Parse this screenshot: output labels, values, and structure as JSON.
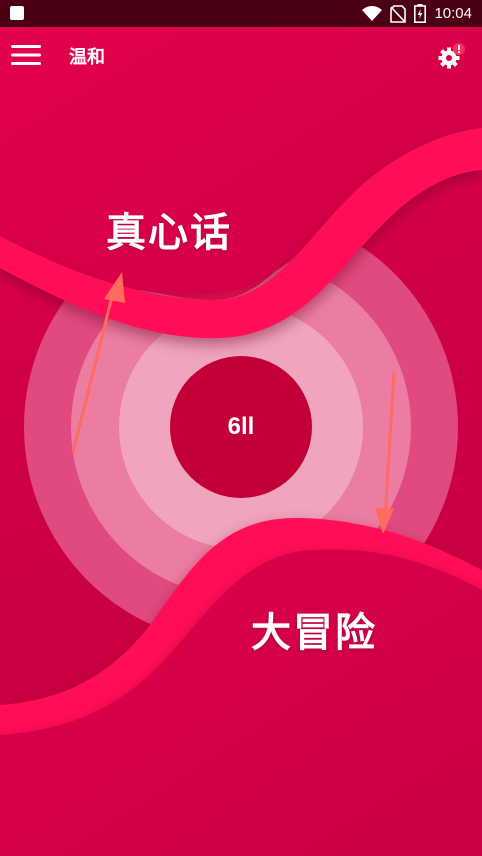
{
  "status_bar": {
    "time": "10:04",
    "icons": [
      "stop-square-icon",
      "wifi-icon",
      "no-sim-icon",
      "battery-charging-icon"
    ]
  },
  "app_bar": {
    "menu_icon": "hamburger-menu-icon",
    "mode_label": "温和",
    "settings_icon": "gear-alert-icon"
  },
  "game": {
    "truth_label": "真心话",
    "dare_label": "大冒险",
    "center_count": "6ll"
  },
  "colors": {
    "background": "#cf0046",
    "status_bar": "#4b0014",
    "wave": "#ff1a5e",
    "center_circle": "#c20037",
    "arrow": "#ff6b5e"
  }
}
